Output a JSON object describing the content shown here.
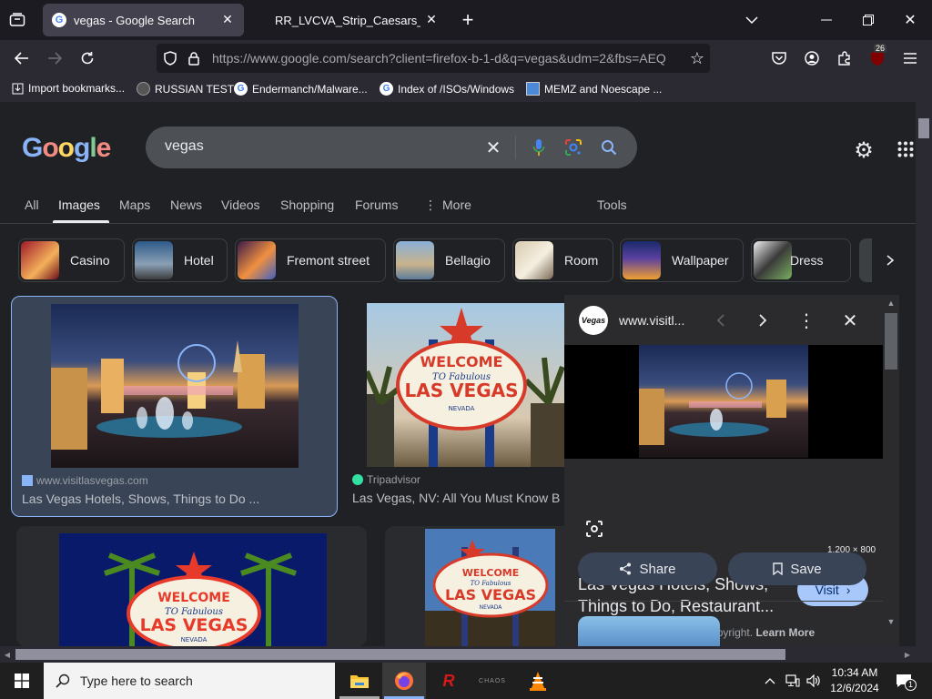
{
  "browser": {
    "tabs": [
      {
        "title": "vegas - Google Search",
        "active": true
      },
      {
        "title": "RR_LVCVA_Strip_Caesars_Bellag",
        "active": false
      }
    ],
    "url": "https://www.google.com/search?client=firefox-b-1-d&q=vegas&udm=2&fbs=AEQ",
    "extension_badge": "26",
    "bookmarks": [
      {
        "label": "Import bookmarks..."
      },
      {
        "label": "RUSSIAN TEST"
      },
      {
        "label": "Endermanch/Malware..."
      },
      {
        "label": "Index of /ISOs/Windows"
      },
      {
        "label": "MEMZ and Noescape ..."
      }
    ]
  },
  "google": {
    "query": "vegas",
    "nav_tabs": [
      {
        "label": "All"
      },
      {
        "label": "Images",
        "active": true
      },
      {
        "label": "Maps"
      },
      {
        "label": "News"
      },
      {
        "label": "Videos"
      },
      {
        "label": "Shopping"
      },
      {
        "label": "Forums"
      },
      {
        "label": "More"
      }
    ],
    "tools_label": "Tools",
    "chips": [
      {
        "label": "Casino"
      },
      {
        "label": "Hotel"
      },
      {
        "label": "Fremont street"
      },
      {
        "label": "Bellagio"
      },
      {
        "label": "Room"
      },
      {
        "label": "Wallpaper"
      },
      {
        "label": "Dress"
      }
    ],
    "results": [
      {
        "source": "www.visitlasvegas.com",
        "title": "Las Vegas Hotels, Shows, Things to Do ..."
      },
      {
        "source": "Tripadvisor",
        "title": "Las Vegas, NV: All You Must Know B"
      }
    ],
    "sign_text": {
      "welcome": "WELCOME",
      "to_fabulous": "TO Fabulous",
      "las_vegas": "LAS VEGAS",
      "nevada": "NEVADA"
    }
  },
  "panel": {
    "site": "www.visitl...",
    "dimensions": "1,200 × 800",
    "title_line1": "Las Vegas Hotels, Shows,",
    "title_line2": "Things to Do, Restaurant...",
    "visit_label": "Visit",
    "copyright_text": "Images may be subject to copyright.",
    "learn_more": "Learn More",
    "share_label": "Share",
    "save_label": "Save"
  },
  "taskbar": {
    "search_placeholder": "Type here to search",
    "time": "10:34 AM",
    "date": "12/6/2024",
    "notification_count": "1"
  },
  "colors": {
    "accent_blue": "#8ab4f8",
    "page_bg": "#202124",
    "chrome_bg": "#2b2a33"
  }
}
